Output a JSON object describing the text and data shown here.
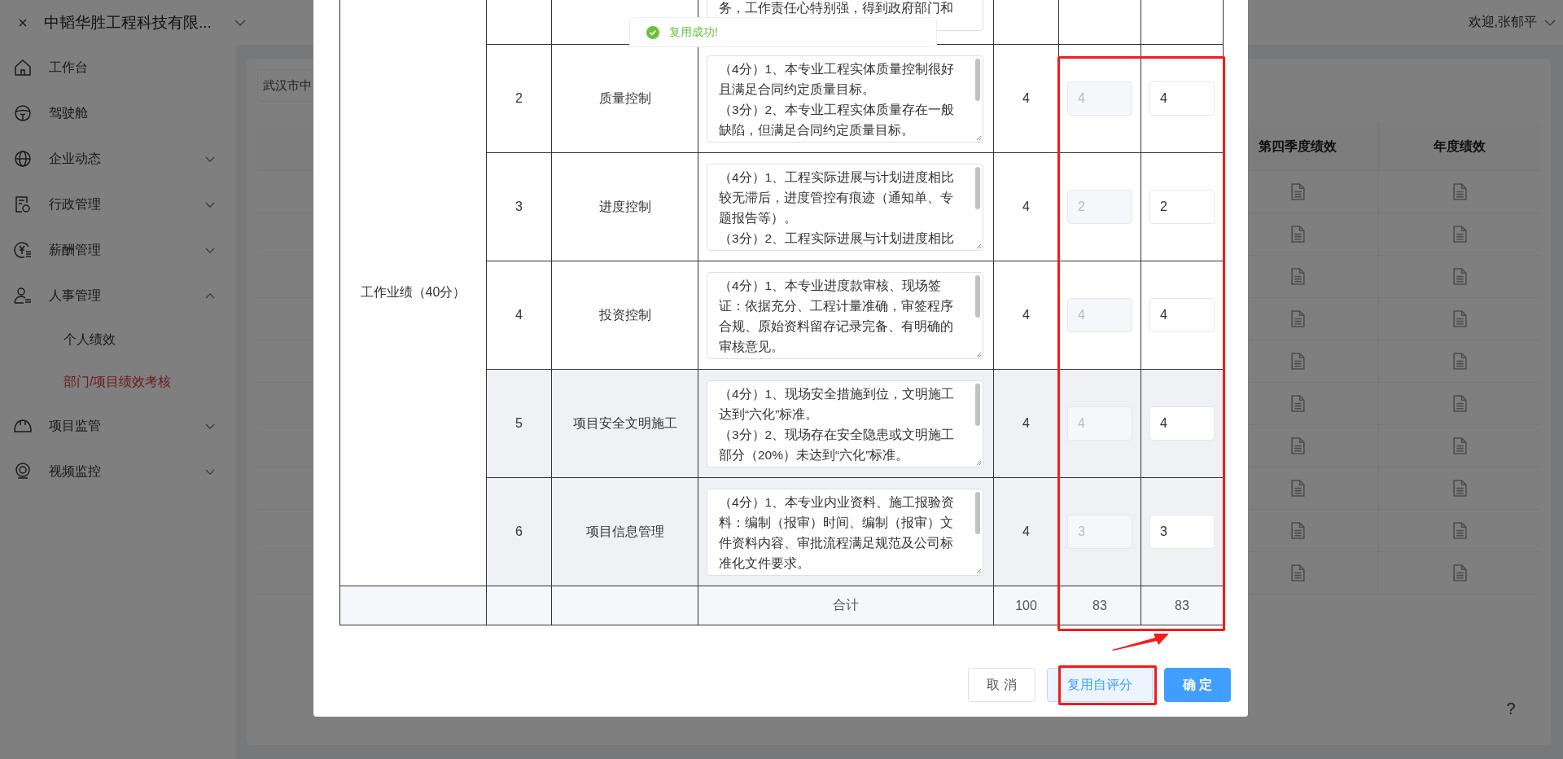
{
  "topbar": {
    "company": "中韬华胜工程科技有限...",
    "user": "欢迎,张郁平"
  },
  "sidebar": {
    "items": [
      {
        "label": "工作台"
      },
      {
        "label": "驾驶舱"
      },
      {
        "label": "企业动态",
        "expanded": false
      },
      {
        "label": "行政管理",
        "expanded": false
      },
      {
        "label": "薪酬管理",
        "expanded": false
      },
      {
        "label": "人事管理",
        "expanded": true,
        "children": [
          {
            "label": "个人绩效",
            "selected": false
          },
          {
            "label": "部门/项目绩效考核",
            "selected": true
          }
        ]
      },
      {
        "label": "项目监管",
        "expanded": false
      },
      {
        "label": "视频监控",
        "expanded": false
      }
    ]
  },
  "content": {
    "breadcrumb": "武汉市中",
    "table_columns": [
      "第四季度绩效",
      "年度绩效"
    ]
  },
  "dialog": {
    "partial_row": {
      "criteria": "务，工作责任心特别强，得到政府部门和"
    },
    "group_label": "工作业绩（40分）",
    "rows": [
      {
        "index": "2",
        "item": "质量控制",
        "criteria": [
          "（4分）1、本专业工程实体质量控制很好且满足合同约定质量目标。",
          "（3分）2、本专业工程实体质量存在一般缺陷，但满足合同约定质量目标。"
        ],
        "max_score": "4",
        "self_score": "4",
        "score": "4",
        "highlighted": false
      },
      {
        "index": "3",
        "item": "进度控制",
        "criteria": [
          "（4分）1、工程实际进展与计划进度相比较无滞后，进度管控有痕迹（通知单、专题报告等）。",
          "（3分）2、工程实际进展与计划进度相比"
        ],
        "max_score": "4",
        "self_score": "2",
        "score": "2",
        "highlighted": false
      },
      {
        "index": "4",
        "item": "投资控制",
        "criteria": [
          "（4分）1、本专业进度款审核、现场签证：依据充分、工程计量准确，审签程序合规、原始资料留存记录完备、有明确的审核意见。"
        ],
        "max_score": "4",
        "self_score": "4",
        "score": "4",
        "highlighted": false
      },
      {
        "index": "5",
        "item": "项目安全文明施工",
        "criteria": [
          "（4分）1、现场安全措施到位，文明施工达到“六化”标准。",
          "（3分）2、现场存在安全隐患或文明施工部分（20%）未达到“六化”标准。"
        ],
        "max_score": "4",
        "self_score": "4",
        "score": "4",
        "highlighted": true
      },
      {
        "index": "6",
        "item": "项目信息管理",
        "criteria": [
          "（4分）1、本专业内业资料、施工报验资料：编制（报审）时间、编制（报审）文件资料内容、审批流程满足规范及公司标准化文件要求。"
        ],
        "max_score": "4",
        "self_score": "3",
        "score": "3",
        "highlighted": true
      }
    ],
    "total": {
      "label": "合计",
      "max_score": "100",
      "self_score": "83",
      "score": "83"
    },
    "buttons": [
      {
        "label": "取 消",
        "kind": "default"
      },
      {
        "label": "复用自评分",
        "kind": "plain"
      },
      {
        "label": "确 定",
        "kind": "primary"
      }
    ]
  },
  "toast": {
    "kind": "success",
    "text": "复用成功!"
  },
  "help_button": "?"
}
